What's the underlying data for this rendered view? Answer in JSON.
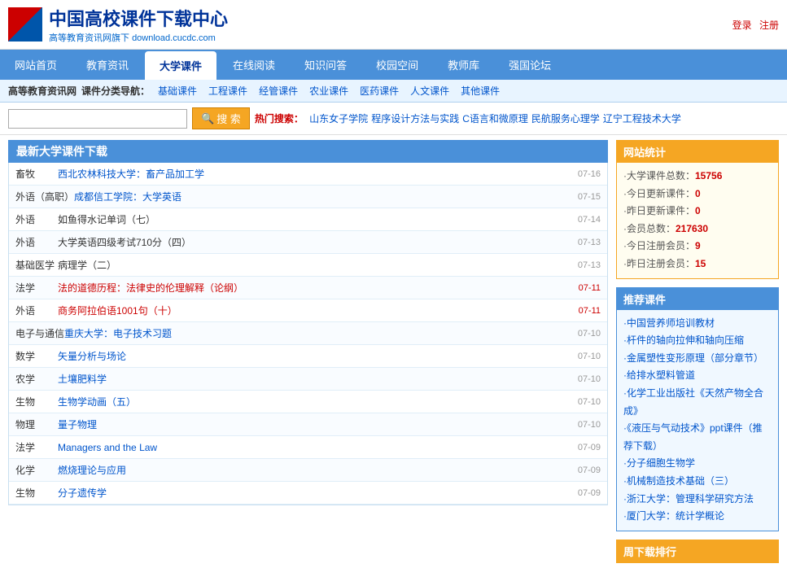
{
  "header": {
    "logo_title": "中国高校课件下载中心",
    "logo_subtitle_text": "高等教育资讯网旗下",
    "logo_subtitle_url": "download.cucdc.com",
    "login_label": "登录",
    "register_label": "注册"
  },
  "nav": {
    "items": [
      {
        "label": "网站首页",
        "active": false
      },
      {
        "label": "教育资讯",
        "active": false
      },
      {
        "label": "大学课件",
        "active": true
      },
      {
        "label": "在线阅读",
        "active": false
      },
      {
        "label": "知识问答",
        "active": false
      },
      {
        "label": "校园空间",
        "active": false
      },
      {
        "label": "教师库",
        "active": false
      },
      {
        "label": "强国论坛",
        "active": false
      }
    ]
  },
  "cat_nav": {
    "prefix": "高等教育资讯网",
    "label": "课件分类导航：",
    "links": [
      "基础课件",
      "工程课件",
      "经管课件",
      "农业课件",
      "医药课件",
      "人文课件",
      "其他课件"
    ]
  },
  "search": {
    "placeholder": "",
    "button_label": "搜  索",
    "hot_label": "热门搜索：",
    "hot_links": [
      "山东女子学院",
      "程序设计方法与实践",
      "C语言和微原理",
      "民航服务心理学",
      "辽宁工程技术大学"
    ]
  },
  "course_list": {
    "section_title": "最新大学课件下载",
    "items": [
      {
        "cat": "畜牧",
        "title": "西北农林科技大学：畜产品加工学",
        "date": "07-16",
        "highlight": false,
        "link_color": "normal"
      },
      {
        "cat": "外语",
        "sub": "（高职）",
        "title": "成都信工学院：大学英语",
        "date": "07-15",
        "highlight": false,
        "link_color": "normal"
      },
      {
        "cat": "外语",
        "title": "如鱼得水记单词（七）",
        "date": "07-14",
        "highlight": false,
        "link_color": "plain"
      },
      {
        "cat": "外语",
        "title": "大学英语四级考试710分（四）",
        "date": "07-13",
        "highlight": false,
        "link_color": "plain"
      },
      {
        "cat": "基础医学",
        "title": "病理学（二）",
        "date": "07-13",
        "highlight": false,
        "link_color": "plain"
      },
      {
        "cat": "法学",
        "title": "法的道德历程：法律史的伦理解释（论纲）",
        "date": "07-11",
        "highlight": true,
        "link_color": "red"
      },
      {
        "cat": "外语",
        "title": "商务阿拉伯语1001句（十）",
        "date": "07-11",
        "highlight": true,
        "link_color": "red"
      },
      {
        "cat": "电子与通信",
        "title": "重庆大学：电子技术习题",
        "date": "07-10",
        "highlight": false,
        "link_color": "normal"
      },
      {
        "cat": "数学",
        "title": "矢量分析与场论",
        "date": "07-10",
        "highlight": false,
        "link_color": "normal"
      },
      {
        "cat": "农学",
        "title": "土壤肥料学",
        "date": "07-10",
        "highlight": false,
        "link_color": "normal"
      },
      {
        "cat": "生物",
        "title": "生物学动画（五）",
        "date": "07-10",
        "highlight": false,
        "link_color": "normal"
      },
      {
        "cat": "物理",
        "title": "量子物理",
        "date": "07-10",
        "highlight": false,
        "link_color": "normal"
      },
      {
        "cat": "法学",
        "title": "Managers and the Law",
        "date": "07-09",
        "highlight": false,
        "link_color": "normal"
      },
      {
        "cat": "化学",
        "title": "燃烧理论与应用",
        "date": "07-09",
        "highlight": false,
        "link_color": "normal"
      },
      {
        "cat": "生物",
        "title": "分子遗传学",
        "date": "07-09",
        "highlight": false,
        "link_color": "normal"
      }
    ]
  },
  "stats": {
    "title": "网站统计",
    "items": [
      {
        "label": "·大学课件总数：",
        "value": "15756"
      },
      {
        "label": "·今日更新课件：",
        "value": "0"
      },
      {
        "label": "·昨日更新课件：",
        "value": "0"
      },
      {
        "label": "·会员总数：",
        "value": "217630"
      },
      {
        "label": "·今日注册会员：",
        "value": "9"
      },
      {
        "label": "·昨日注册会员：",
        "value": "15"
      }
    ]
  },
  "recommend": {
    "title": "推荐课件",
    "links": [
      "·中国营养师培训教材",
      "·杆件的轴向拉伸和轴向压缩",
      "·金属塑性变形原理（部分章节）",
      "·给排水塑料管道",
      "·化学工业出版社《天然产物全合成》",
      "·《液压与气动技术》ppt课件（推荐下载）",
      "·分子细胞生物学",
      "·机械制造技术基础（三）",
      "·浙江大学：管理科学研究方法",
      "·厦门大学：统计学概论"
    ]
  },
  "weekly": {
    "title": "周下载排行"
  }
}
